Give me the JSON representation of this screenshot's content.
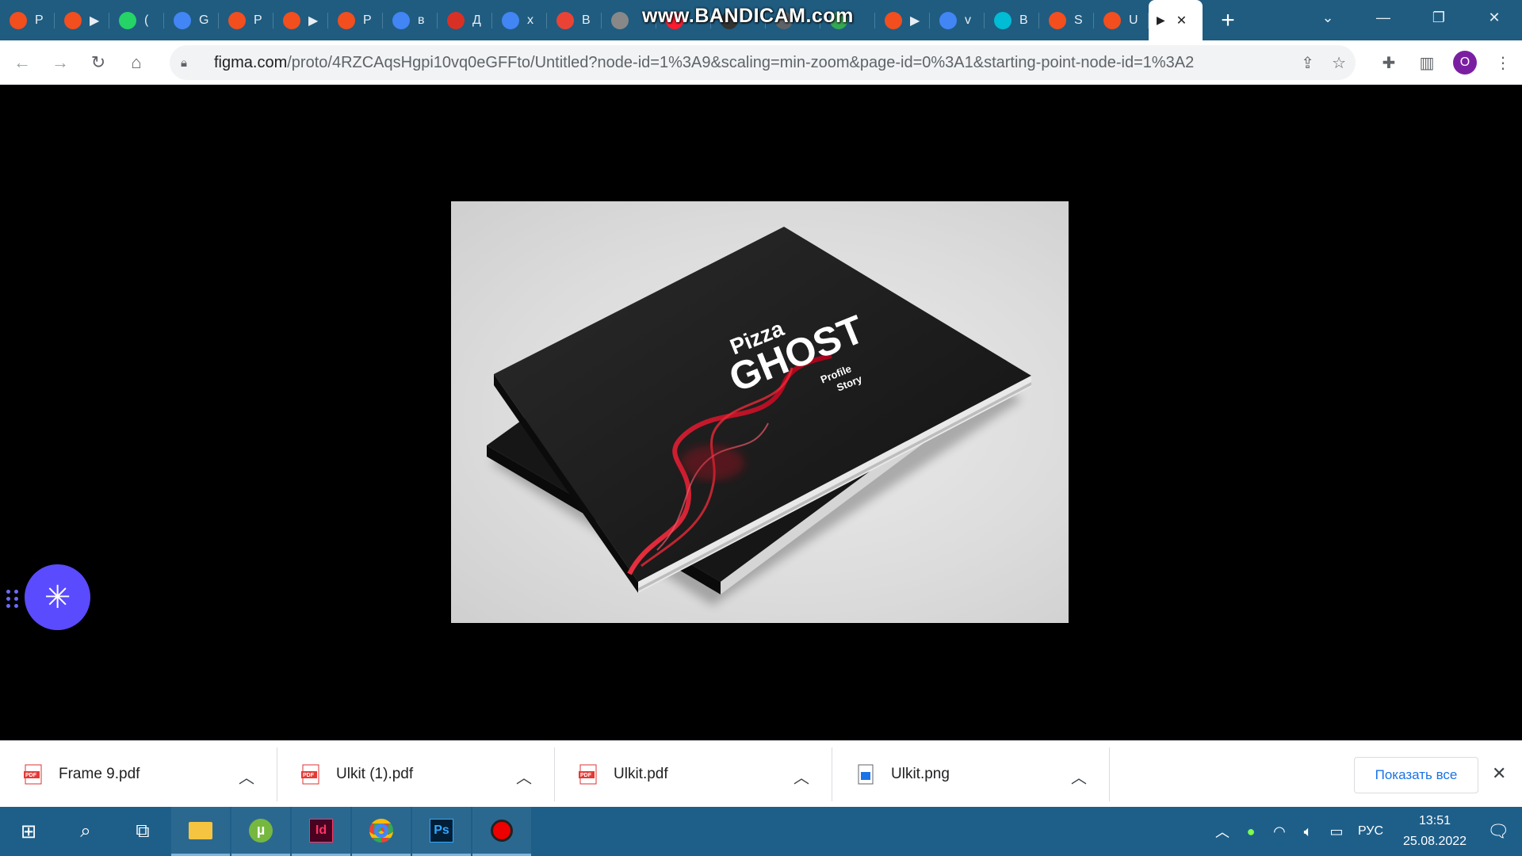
{
  "browser": {
    "watermark": "www.BANDICAM.com",
    "tabs": [
      {
        "icon": "figma-icon",
        "title": "P",
        "color": "#f24e1e"
      },
      {
        "icon": "figma-icon",
        "title": "▶",
        "color": "#f24e1e"
      },
      {
        "icon": "whatsapp-icon",
        "title": "(",
        "color": "#25d366"
      },
      {
        "icon": "google-translate-icon",
        "title": "G",
        "color": "#4285f4"
      },
      {
        "icon": "figma-icon",
        "title": "P",
        "color": "#f24e1e"
      },
      {
        "icon": "figma-icon",
        "title": "▶",
        "color": "#f24e1e"
      },
      {
        "icon": "figma-icon",
        "title": "P",
        "color": "#f24e1e"
      },
      {
        "icon": "google-icon",
        "title": "в",
        "color": "#4285f4"
      },
      {
        "icon": "red-g-icon",
        "title": "Д",
        "color": "#d93025"
      },
      {
        "icon": "google-icon",
        "title": "x",
        "color": "#4285f4"
      },
      {
        "icon": "gmail-icon",
        "title": "B",
        "color": "#ea4335"
      },
      {
        "icon": "globe-icon",
        "title": "",
        "color": "#888"
      },
      {
        "icon": "opera-icon",
        "title": "",
        "color": "#ff1b2d"
      },
      {
        "icon": "video-icon",
        "title": "",
        "color": "#333"
      },
      {
        "icon": "link-icon",
        "title": "",
        "color": "#5f6368"
      },
      {
        "icon": "green-icon",
        "title": "",
        "color": "#34a853"
      },
      {
        "icon": "figma-icon",
        "title": "▶",
        "color": "#f24e1e"
      },
      {
        "icon": "google-icon",
        "title": "v",
        "color": "#4285f4"
      },
      {
        "icon": "tool-icon",
        "title": "B",
        "color": "#00bcd4"
      },
      {
        "icon": "figma-icon",
        "title": "S",
        "color": "#f24e1e"
      },
      {
        "icon": "figma-icon",
        "title": "U",
        "color": "#f24e1e"
      }
    ],
    "active_tab": {
      "icon": "play-icon",
      "title": "▶"
    },
    "url_host": "figma.com",
    "url_rest": "/proto/4RZCAqsHgpi10vq0eGFFto/Untitled?node-id=1%3A9&scaling=min-zoom&page-id=0%3A1&starting-point-node-id=1%3A2",
    "profile_initial": "O"
  },
  "prototype": {
    "image_alt": "Pizza Ghost Profile Story book mockup",
    "cover_title_small": "Pizza",
    "cover_title_big": "GHOST",
    "cover_subtitle_1": "Profile",
    "cover_subtitle_2": "Story"
  },
  "downloads": {
    "items": [
      {
        "name": "Frame 9.pdf",
        "type": "pdf"
      },
      {
        "name": "Ulkit (1).pdf",
        "type": "pdf"
      },
      {
        "name": "Ulkit.pdf",
        "type": "pdf"
      },
      {
        "name": "Ulkit.png",
        "type": "png"
      }
    ],
    "show_all": "Показать все"
  },
  "taskbar": {
    "lang": "РУС",
    "time": "13:51",
    "date": "25.08.2022"
  }
}
